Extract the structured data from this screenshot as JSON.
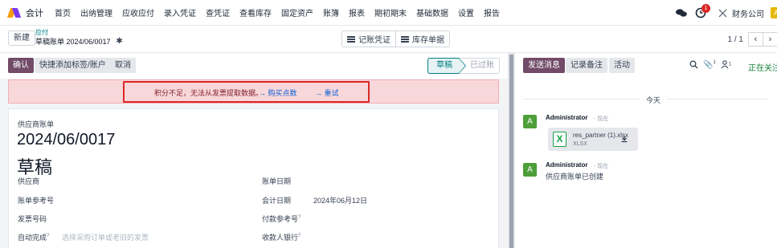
{
  "navbar": {
    "app_name": "会计",
    "menu": [
      "首页",
      "出纳管理",
      "应收应付",
      "录入凭证",
      "查凭证",
      "查看库存",
      "固定资产",
      "账簿",
      "报表",
      "期初期末",
      "基础数据",
      "设置",
      "报告"
    ],
    "notification_count": "1",
    "company": "财务公司",
    "user_initial": "A"
  },
  "control_panel": {
    "new_button": "新建",
    "breadcrumb_parent": "应付",
    "breadcrumb_current": "草稿账单 2024/06/0017",
    "smart_buttons": [
      "记账凭证",
      "库存单据"
    ],
    "pager_value": "1 / 1"
  },
  "statusbar": {
    "confirm": "确认",
    "add_tag": "快捷添加标签/账户",
    "cancel": "取消",
    "steps": [
      "草稿",
      "已过账"
    ]
  },
  "alert": {
    "message": "积分不足，无法从发票提取数据。",
    "buy_credits": "→ 购买点数",
    "retry": "→ 重试"
  },
  "sheet": {
    "doc_type": "供应商账单",
    "number": "2024/06/0017",
    "state": "草稿",
    "fields_left": [
      {
        "label": "供应商",
        "help": "",
        "value": ""
      },
      {
        "label": "账单参考号",
        "help": "",
        "value": ""
      },
      {
        "label": "发票号码",
        "help": "",
        "value": ""
      },
      {
        "label": "自动完成",
        "help": "?",
        "value": "选择采购订单或老旧的发票"
      }
    ],
    "fields_right": [
      {
        "label": "账单日期",
        "help": "",
        "value": ""
      },
      {
        "label": "会计日期",
        "help": "",
        "value": "2024年06月12日"
      },
      {
        "label": "付款参考号",
        "help": "?",
        "value": ""
      },
      {
        "label": "收款人银行",
        "help": "?",
        "value": ""
      }
    ]
  },
  "chatter": {
    "send_message": "发送消息",
    "log_note": "记录备注",
    "activity": "活动",
    "attachment_count": "1",
    "follower_count": "1",
    "following": "正在关注",
    "today": "今天",
    "messages": [
      {
        "avatar": "A",
        "author": "Administrator",
        "time": "- 现在",
        "attachment_name": "res_partner (1).xlsx",
        "attachment_ext": "XLSX"
      },
      {
        "avatar": "A",
        "author": "Administrator",
        "time": "- 现在",
        "body": "供应商账单已创建"
      }
    ]
  },
  "colors": {
    "brand": "#714b67",
    "teal": "#017e84",
    "alert_bg": "#f8d7da",
    "highlight": "#dc2626",
    "avatar": "#4d9f3a"
  }
}
